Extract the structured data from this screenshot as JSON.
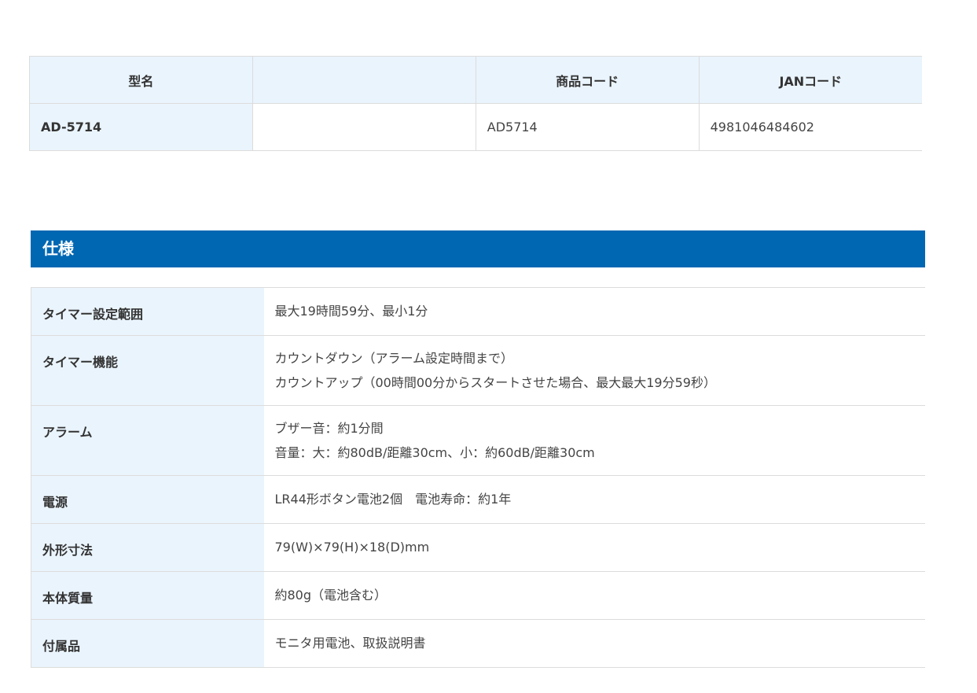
{
  "model_table": {
    "headers": [
      "型名",
      "",
      "商品コード",
      "JANコード"
    ],
    "row": {
      "model": "AD-5714",
      "blank": "",
      "product_code": "AD5714",
      "jan_code": "4981046484602"
    }
  },
  "spec": {
    "title": "仕様",
    "rows": [
      {
        "label": "タイマー設定範囲",
        "values": [
          "最大19時間59分、最小1分"
        ]
      },
      {
        "label": "タイマー機能",
        "values": [
          "カウントダウン（アラーム設定時間まで）",
          "カウントアップ（00時間00分からスタートさせた場合、最大最大19分59秒）"
        ]
      },
      {
        "label": "アラーム",
        "values": [
          "ブザー音：約1分間",
          "音量：大：約80dB/距離30cm、小：約60dB/距離30cm"
        ]
      },
      {
        "label": "電源",
        "values": [
          "LR44形ボタン電池2個　電池寿命：約1年"
        ]
      },
      {
        "label": "外形寸法",
        "values": [
          "79(W)×79(H)×18(D)mm"
        ]
      },
      {
        "label": "本体質量",
        "values": [
          "約80g（電池含む）"
        ]
      },
      {
        "label": "付属品",
        "values": [
          "モニタ用電池、取扱説明書"
        ]
      }
    ]
  },
  "colors": {
    "header_blue": "#0067b3",
    "cell_light_blue": "#eaf4fd",
    "border": "#dcdcdc"
  }
}
